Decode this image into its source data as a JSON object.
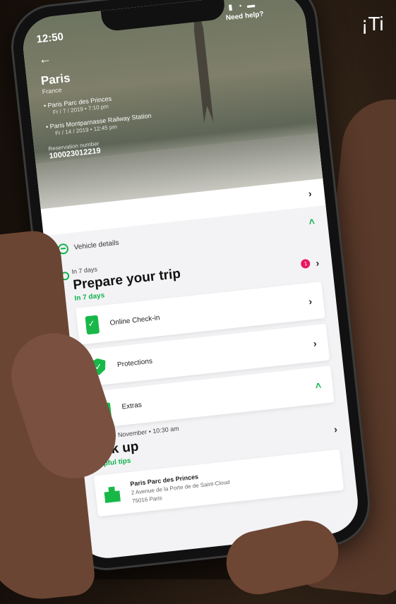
{
  "banner": "¡Ti",
  "status": {
    "time": "12:50",
    "icons": "▮ ◔ ▬",
    "help": "Need help?"
  },
  "header": {
    "back": "←",
    "city": "Paris",
    "country": "France",
    "locations": [
      {
        "name": "Paris Parc des Princes",
        "date": "Fr / 7 / 2019 • 7:10 pm"
      },
      {
        "name": "Paris Montparnasse Railway Station",
        "date": "Fr / 14 / 2019 • 12:45 pm"
      }
    ],
    "reservation_label": "Reservation number",
    "reservation_number": "100023012219"
  },
  "vehicle": {
    "label": "Vehicle details"
  },
  "prepare": {
    "when": "In 7 days",
    "title": "Prepare your trip",
    "subtitle": "In 7 days",
    "badge": "1"
  },
  "tasks": [
    {
      "label": "Online Check-in"
    },
    {
      "label": "Protections"
    },
    {
      "label": "Extras"
    }
  ],
  "pickup": {
    "when": "Friday 19 November • 10:30 am",
    "title": "Pick up",
    "subtitle": "Helpful tips"
  },
  "address": {
    "name": "Paris Parc des Princes",
    "line1": "2 Avenue de la Porte de de Saint-Cloud",
    "line2": "75016 Paris"
  }
}
